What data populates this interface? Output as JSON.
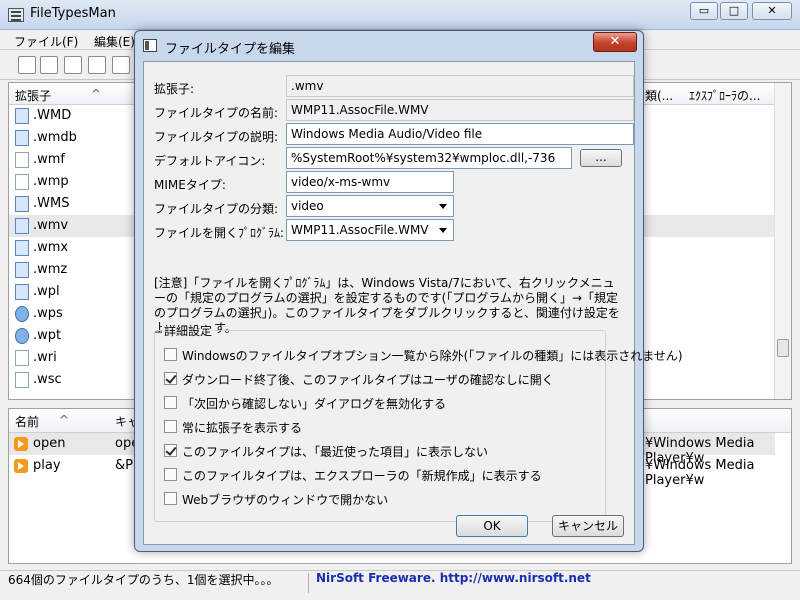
{
  "main": {
    "title": "FileTypesMan",
    "window_buttons": {
      "minimize": "▭",
      "maximize": "□",
      "close": "✕"
    },
    "menu": [
      "ファイル(F)",
      "編集(E)"
    ],
    "toolbar_icons": [
      "save-icon",
      "refresh-icon",
      "copy-icon",
      "properties-icon",
      "edit-icon"
    ],
    "list": {
      "columns": [
        "拡張子",
        "類(...",
        "ｴｸｽﾌﾟﾛｰﾗの..."
      ],
      "rows": [
        {
          "ext": ".WMD",
          "icon": "wmd-file-icon",
          "style": "blue"
        },
        {
          "ext": ".wmdb",
          "icon": "wmdb-file-icon",
          "style": "blue"
        },
        {
          "ext": ".wmf",
          "icon": "wmf-file-icon",
          "style": "plain"
        },
        {
          "ext": ".wmp",
          "icon": "wmp-file-icon",
          "style": "plain"
        },
        {
          "ext": ".WMS",
          "icon": "wms-file-icon",
          "style": "blue"
        },
        {
          "ext": ".wmv",
          "icon": "wmv-file-icon",
          "style": "blue",
          "selected": true
        },
        {
          "ext": ".wmx",
          "icon": "wmx-file-icon",
          "style": "blue"
        },
        {
          "ext": ".wmz",
          "icon": "wmz-file-icon",
          "style": "blue"
        },
        {
          "ext": ".wpl",
          "icon": "wpl-file-icon",
          "style": "blue"
        },
        {
          "ext": ".wps",
          "icon": "wps-file-icon",
          "style": "earth"
        },
        {
          "ext": ".wpt",
          "icon": "wpt-file-icon",
          "style": "earth"
        },
        {
          "ext": ".wri",
          "icon": "wri-file-icon",
          "style": "plain"
        },
        {
          "ext": ".wsc",
          "icon": "wsc-file-icon",
          "style": "plain"
        }
      ]
    },
    "actions": {
      "columns": [
        "名前",
        "キャ"
      ],
      "rows": [
        {
          "name": "open",
          "caption": "ope",
          "command": "¥Windows Media Player¥w",
          "selected": true
        },
        {
          "name": "play",
          "caption": "&Pl",
          "command": "¥Windows Media Player¥w"
        }
      ]
    },
    "status": {
      "left": "664個のファイルタイプのうち、1個を選択中。。。",
      "right": "NirSoft Freeware.  http://www.nirsoft.net"
    }
  },
  "dialog": {
    "title": "ファイルタイプを編集",
    "close_label": "✕",
    "fields": {
      "extension_label": "拡張子:",
      "extension_value": ".wmv",
      "type_name_label": "ファイルタイプの名前:",
      "type_name_value": "WMP11.AssocFile.WMV",
      "description_label": "ファイルタイプの説明:",
      "description_value": "Windows Media Audio/Video file",
      "default_icon_label": "デフォルトアイコン:",
      "default_icon_value": "%SystemRoot%¥system32¥wmploc.dll,-736",
      "browse_label": "...",
      "mime_label": "MIMEタイプ:",
      "mime_value": "video/x-ms-wmv",
      "category_label": "ファイルタイプの分類:",
      "category_value": "video",
      "open_program_label": "ファイルを開くﾌﾟﾛｸﾞﾗﾑ:",
      "open_program_value": "WMP11.AssocFile.WMV"
    },
    "note": "[注意]「ファイルを開くﾌﾟﾛｸﾞﾗﾑ」は、Windows Vista/7において、右クリックメニューの「規定のプログラムの選択」を設定するものです(「プログラムから開く」→「規定のプログラムの選択」)。このファイルタイプをダブルクリックすると、関連付け設定を上書きします。",
    "group_title": "詳細設定",
    "options": [
      {
        "label": "Windowsのファイルタイプオプション一覧から除外(「ファイルの種類」には表示されません)",
        "checked": false
      },
      {
        "label": "ダウンロード終了後、このファイルタイプはユーザの確認なしに開く",
        "checked": true
      },
      {
        "label": "「次回から確認しない」ダイアログを無効化する",
        "checked": false
      },
      {
        "label": "常に拡張子を表示する",
        "checked": false
      },
      {
        "label": "このファイルタイプは、「最近使った項目」に表示しない",
        "checked": true
      },
      {
        "label": "このファイルタイプは、エクスプローラの「新規作成」に表示する",
        "checked": false
      },
      {
        "label": "Webブラウザのウィンドウで開かない",
        "checked": false
      }
    ],
    "ok_label": "OK",
    "cancel_label": "キャンセル"
  },
  "colors": {
    "titlebar": "#c6d6ec",
    "dialog_frame": "#c7d7ec",
    "close_red": "#c4412a",
    "selected_row": "#e8e8e8",
    "status_link": "#1a2fb0"
  }
}
